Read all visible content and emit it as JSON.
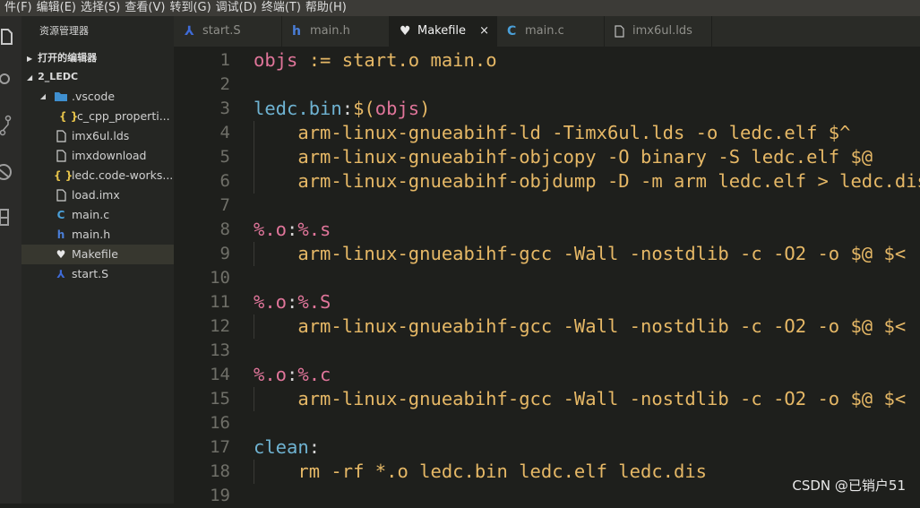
{
  "menu": [
    "件(F)",
    "编辑(E)",
    "选择(S)",
    "查看(V)",
    "转到(G)",
    "调试(D)",
    "终端(T)",
    "帮助(H)"
  ],
  "explorer": {
    "title": "资源管理器",
    "open_editors": "打开的编辑器",
    "folder": "2_LEDC",
    "items": [
      {
        "label": ".vscode",
        "icon": "folder-icon",
        "glyph": "▸",
        "color": "#4a9fd8"
      },
      {
        "label": "c_cpp_properti...",
        "icon": "json-icon",
        "glyph": "{ }",
        "color": "#e6c34a"
      },
      {
        "label": "imx6ul.lds",
        "icon": "file-icon",
        "glyph": "",
        "color": "#cfcfcf"
      },
      {
        "label": "imxdownload",
        "icon": "file-icon",
        "glyph": "",
        "color": "#cfcfcf"
      },
      {
        "label": "ledc.code-works...",
        "icon": "json-icon",
        "glyph": "{ }",
        "color": "#e6c34a"
      },
      {
        "label": "load.imx",
        "icon": "file-icon",
        "glyph": "",
        "color": "#cfcfcf"
      },
      {
        "label": "main.c",
        "icon": "c-file-icon",
        "glyph": "C",
        "color": "#4a9fd8"
      },
      {
        "label": "main.h",
        "icon": "h-file-icon",
        "glyph": "h",
        "color": "#4a7ed8"
      },
      {
        "label": "Makefile",
        "icon": "makefile-icon",
        "glyph": "♥",
        "color": "#e8e8e8"
      },
      {
        "label": "start.S",
        "icon": "asm-file-icon",
        "glyph": "⅄",
        "color": "#3f6bd8"
      }
    ]
  },
  "tabs": [
    {
      "label": "start.S",
      "icon": "asm-file-icon",
      "glyph": "⅄",
      "color": "#3f6bd8"
    },
    {
      "label": "main.h",
      "icon": "h-file-icon",
      "glyph": "h",
      "color": "#4a7ed8"
    },
    {
      "label": "Makefile",
      "icon": "makefile-icon",
      "glyph": "♥",
      "color": "#e8e8e8"
    },
    {
      "label": "main.c",
      "icon": "c-file-icon",
      "glyph": "C",
      "color": "#4a9fd8"
    },
    {
      "label": "imx6ul.lds",
      "icon": "file-icon",
      "glyph": "▯",
      "color": "#bfbfbf"
    }
  ],
  "active_tab": "Makefile",
  "tab_close": "×",
  "colors": {
    "variable": "#f0c674",
    "target": "#6fb3d2",
    "pattern": "#e0759a",
    "recipe": "#e6b866",
    "paren": "#e08ab0",
    "plain": "#d6d6d6"
  },
  "code_lines": [
    {
      "no": "1",
      "tokens": [
        {
          "t": "objs",
          "c": "#e0759a"
        },
        {
          "t": " := start.o main.o",
          "c": "#e6b866"
        }
      ]
    },
    {
      "no": "2",
      "tokens": []
    },
    {
      "no": "3",
      "tokens": [
        {
          "t": "ledc.bin",
          "c": "#6fb3d2"
        },
        {
          "t": ":",
          "c": "#d6d6d6"
        },
        {
          "t": "$(",
          "c": "#e6b866"
        },
        {
          "t": "objs",
          "c": "#e0759a"
        },
        {
          "t": ")",
          "c": "#e6b866"
        }
      ]
    },
    {
      "no": "4",
      "tokens": [
        {
          "t": "    arm-linux-gnueabihf-ld -Timx6ul.lds -o ledc.elf $^",
          "c": "#e6b866"
        }
      ]
    },
    {
      "no": "5",
      "tokens": [
        {
          "t": "    arm-linux-gnueabihf-objcopy -O binary -S ledc.elf $@",
          "c": "#e6b866"
        }
      ]
    },
    {
      "no": "6",
      "tokens": [
        {
          "t": "    arm-linux-gnueabihf-objdump -D -m arm ledc.elf > ledc.dis",
          "c": "#e6b866"
        }
      ]
    },
    {
      "no": "7",
      "tokens": []
    },
    {
      "no": "8",
      "tokens": [
        {
          "t": "%.o",
          "c": "#e0759a"
        },
        {
          "t": ":",
          "c": "#d6d6d6"
        },
        {
          "t": "%.s",
          "c": "#e0759a"
        }
      ]
    },
    {
      "no": "9",
      "tokens": [
        {
          "t": "    arm-linux-gnueabihf-gcc -Wall -nostdlib -c -O2 -o $@ $<",
          "c": "#e6b866"
        }
      ]
    },
    {
      "no": "10",
      "tokens": []
    },
    {
      "no": "11",
      "tokens": [
        {
          "t": "%.o",
          "c": "#e0759a"
        },
        {
          "t": ":",
          "c": "#d6d6d6"
        },
        {
          "t": "%.S",
          "c": "#e0759a"
        }
      ]
    },
    {
      "no": "12",
      "tokens": [
        {
          "t": "    arm-linux-gnueabihf-gcc -Wall -nostdlib -c -O2 -o $@ $<",
          "c": "#e6b866"
        }
      ]
    },
    {
      "no": "13",
      "tokens": []
    },
    {
      "no": "14",
      "tokens": [
        {
          "t": "%.o",
          "c": "#e0759a"
        },
        {
          "t": ":",
          "c": "#d6d6d6"
        },
        {
          "t": "%.c",
          "c": "#e0759a"
        }
      ]
    },
    {
      "no": "15",
      "tokens": [
        {
          "t": "    arm-linux-gnueabihf-gcc -Wall -nostdlib -c -O2 -o $@ $<",
          "c": "#e6b866"
        }
      ]
    },
    {
      "no": "16",
      "tokens": []
    },
    {
      "no": "17",
      "tokens": [
        {
          "t": "clean",
          "c": "#6fb3d2"
        },
        {
          "t": ":",
          "c": "#d6d6d6"
        }
      ]
    },
    {
      "no": "18",
      "tokens": [
        {
          "t": "    rm -rf *.o ledc.bin ledc.elf ledc.dis",
          "c": "#e6b866"
        }
      ]
    },
    {
      "no": "19",
      "tokens": []
    }
  ],
  "watermark": "CSDN @已销户51"
}
